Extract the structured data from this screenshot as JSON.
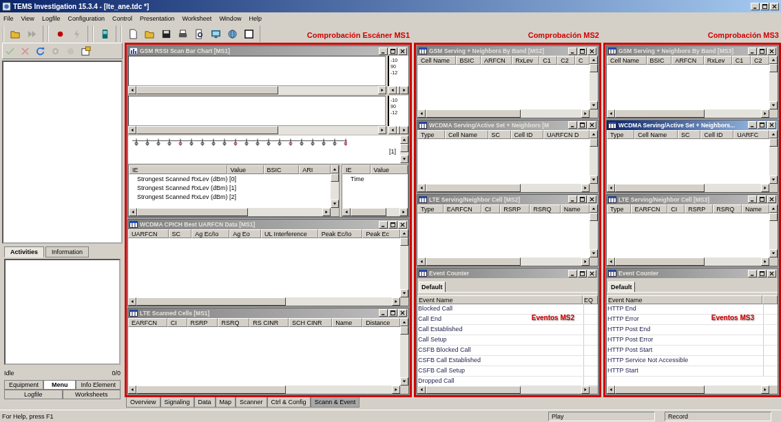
{
  "window": {
    "title": "TEMS Investigation 15.3.4 - [lte_ane.tdc *]"
  },
  "menu": [
    "File",
    "View",
    "Logfile",
    "Configuration",
    "Control",
    "Presentation",
    "Worksheet",
    "Window",
    "Help"
  ],
  "toolbars": [
    [
      {
        "kind": "open",
        "disabled": false
      },
      {
        "kind": "forward",
        "disabled": true
      }
    ],
    [
      {
        "kind": "record",
        "disabled": false
      },
      {
        "kind": "connect",
        "disabled": true
      }
    ],
    [
      {
        "kind": "device",
        "disabled": false
      }
    ],
    [
      {
        "kind": "new",
        "disabled": false
      },
      {
        "kind": "open",
        "disabled": false
      },
      {
        "kind": "save",
        "disabled": false
      },
      {
        "kind": "print",
        "disabled": false
      },
      {
        "kind": "preview",
        "disabled": false
      },
      {
        "kind": "monitor",
        "disabled": false
      },
      {
        "kind": "globe",
        "disabled": false
      },
      {
        "kind": "window",
        "disabled": false
      }
    ]
  ],
  "navigator": {
    "toolbar": [
      {
        "kind": "check",
        "disabled": true
      },
      {
        "kind": "cross",
        "disabled": true
      },
      {
        "kind": "refresh",
        "disabled": false
      },
      {
        "kind": "gear",
        "disabled": true
      },
      {
        "kind": "circle",
        "disabled": true
      },
      {
        "kind": "properties",
        "disabled": false
      }
    ],
    "tabs": [
      {
        "label": "Activities",
        "selected": true
      },
      {
        "label": "Information",
        "selected": false
      }
    ],
    "status": "Idle",
    "count": "0/0",
    "bottom_tabs": [
      [
        {
          "label": "Equipment",
          "selected": false
        },
        {
          "label": "Menu",
          "selected": true
        },
        {
          "label": "Info Element",
          "selected": false
        }
      ],
      [
        {
          "label": "Logfile",
          "selected": false
        },
        {
          "label": "Worksheets",
          "selected": false
        }
      ]
    ]
  },
  "regions": [
    {
      "label": "Comprobación Escáner MS1",
      "windows": [
        {
          "kind": "bar_chart",
          "title": "GSM RSSI Scan Bar Chart [MS1]",
          "active": false,
          "panes": [
            {
              "ticks": [
                "-10",
                "90",
                "-12"
              ]
            },
            {
              "ticks": [
                "-10",
                "90",
                "-12"
              ]
            }
          ],
          "page": "[1]",
          "ie_table": {
            "columns": [
              "IE",
              "Value",
              "BSIC",
              "ARI"
            ],
            "rows": [
              "Strongest Scanned RxLev (dBm) [0]",
              "Strongest Scanned RxLev (dBm) [1]",
              "Strongest Scanned RxLev (dBm) [2]"
            ]
          },
          "side_table": {
            "columns": [
              "IE",
              "Value"
            ],
            "rows": [
              "Time"
            ]
          }
        },
        {
          "kind": "table",
          "title": "WCDMA CPICH Best UARFCN Data [MS1]",
          "active": false,
          "columns": [
            "UARFCN",
            "SC",
            "Ag Ec/Io",
            "Ag Eo",
            "UL Interference",
            "Peak Ec/Io",
            "Peak Ec"
          ]
        },
        {
          "kind": "table",
          "title": "LTE Scanned Cells [MS1]",
          "active": false,
          "columns": [
            "EARFCN",
            "CI",
            "RSRP",
            "RSRQ",
            "RS CINR",
            "SCH CINR",
            "Name",
            "Distance"
          ]
        }
      ]
    },
    {
      "label": "Comprobación MS2",
      "windows": [
        {
          "kind": "table",
          "title": "GSM Serving + Neighbors By Band [MS2]",
          "active": false,
          "columns": [
            "Cell Name",
            "BSIC",
            "ARFCN",
            "RxLev",
            "C1",
            "C2",
            "C"
          ]
        },
        {
          "kind": "table",
          "title": "WCDMA Serving/Active Set + Neighbors [M",
          "active": false,
          "columns": [
            "Type",
            "Cell Name",
            "SC",
            "Cell ID",
            "UARFCN D"
          ]
        },
        {
          "kind": "table",
          "title": "LTE Serving/Neighbor Cell [MS2]",
          "active": false,
          "columns": [
            "Type",
            "EARFCN",
            "CI",
            "RSRP",
            "RSRQ",
            "Name"
          ]
        },
        {
          "kind": "event_counter",
          "title": "Event Counter",
          "active": false,
          "tabs": [
            {
              "label": "Default",
              "selected": true
            }
          ],
          "columns": [
            "Event Name",
            "EQ"
          ],
          "events": [
            "Blocked Call",
            "Call End",
            "Call Established",
            "Call Setup",
            "CSFB Blocked Call",
            "CSFB Call Established",
            "CSFB Call Setup",
            "Dropped Call"
          ],
          "note": "Eventos MS2"
        }
      ]
    },
    {
      "label": "Comprobación MS3",
      "windows": [
        {
          "kind": "table",
          "title": "GSM Serving + Neighbors By Band [MS3]",
          "active": false,
          "columns": [
            "Cell Name",
            "BSIC",
            "ARFCN",
            "RxLev",
            "C1",
            "C2"
          ]
        },
        {
          "kind": "table",
          "title": "WCDMA Serving/Active Set + Neighbors...",
          "active": true,
          "columns": [
            "Type",
            "Cell Name",
            "SC",
            "Cell ID",
            "UARFC"
          ]
        },
        {
          "kind": "table",
          "title": "LTE Serving/Neighbor Cell [MS3]",
          "active": false,
          "columns": [
            "Type",
            "EARFCN",
            "CI",
            "RSRP",
            "RSRQ",
            "Name"
          ]
        },
        {
          "kind": "event_counter",
          "title": "Event Counter",
          "active": false,
          "tabs": [
            {
              "label": "Default",
              "selected": true
            }
          ],
          "columns": [
            "Event Name"
          ],
          "events": [
            "HTTP End",
            "HTTP Error",
            "HTTP Post End",
            "HTTP Post Error",
            "HTTP Post Start",
            "HTTP Service Not Accessible",
            "HTTP Start"
          ],
          "note": "Eventos MS3"
        }
      ]
    }
  ],
  "worksheet_tabs": [
    {
      "label": "Overview",
      "selected": false
    },
    {
      "label": "Signaling",
      "selected": false
    },
    {
      "label": "Data",
      "selected": false
    },
    {
      "label": "Map",
      "selected": false
    },
    {
      "label": "Scanner",
      "selected": false
    },
    {
      "label": "Ctrl & Config",
      "selected": false
    },
    {
      "label": "Scann & Event",
      "selected": true
    }
  ],
  "status_bar": {
    "help": "For Help, press F1",
    "panes": [
      "Play",
      "Record"
    ]
  }
}
